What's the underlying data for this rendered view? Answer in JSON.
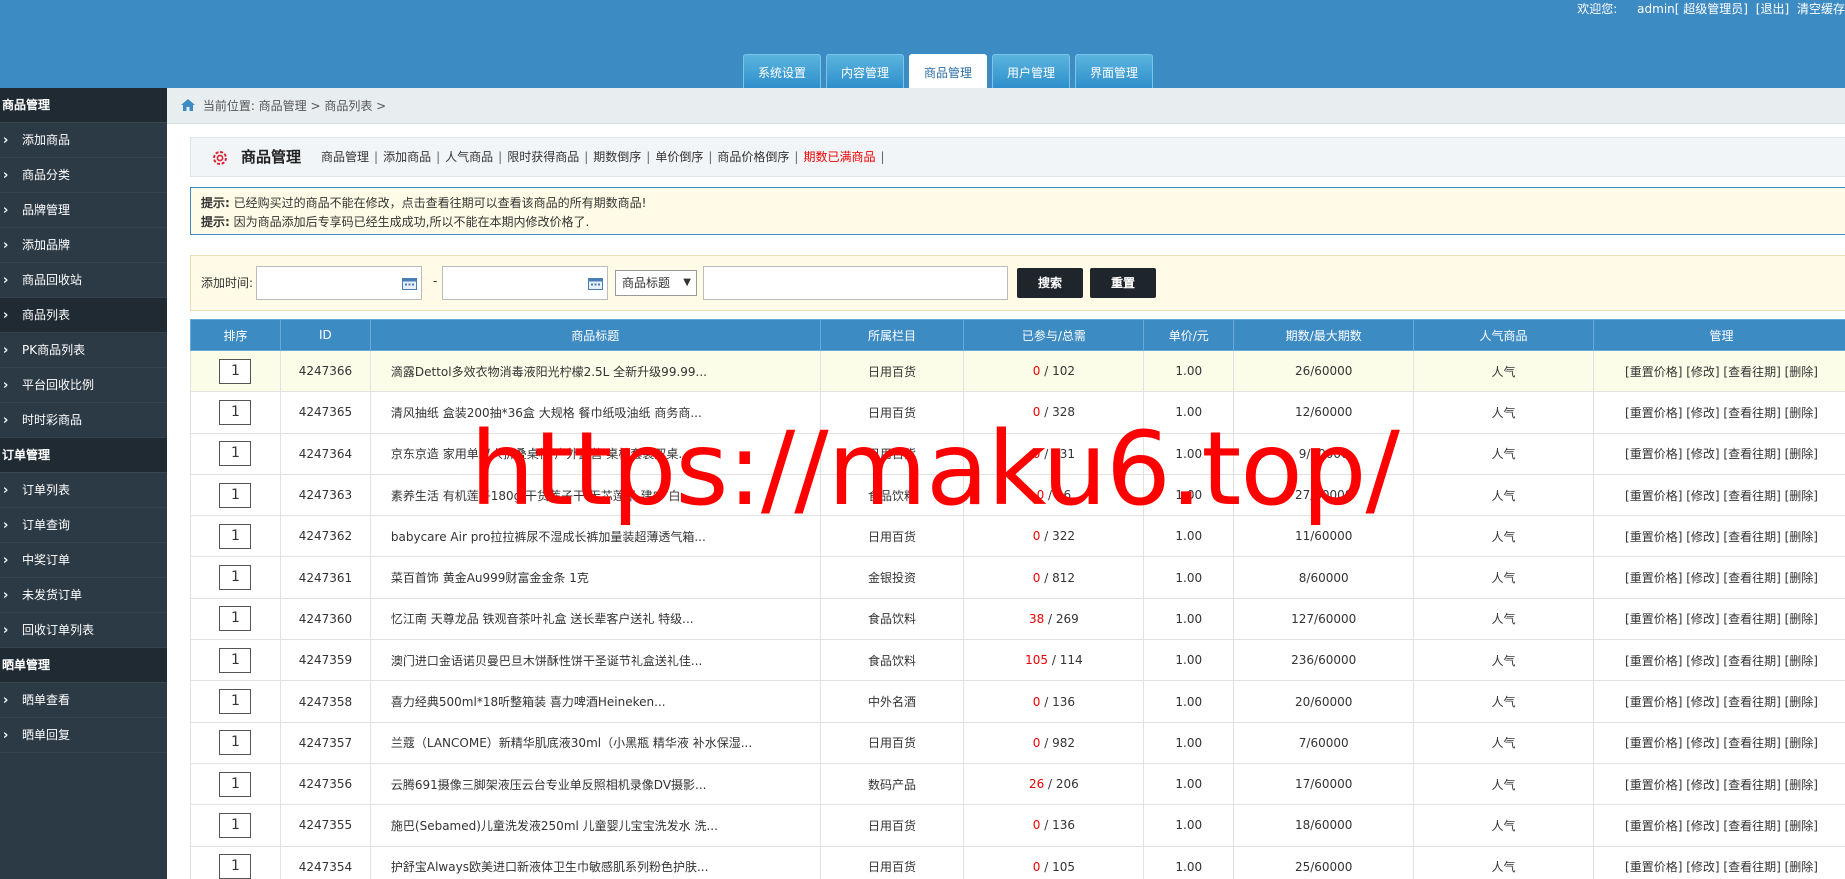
{
  "top_bar": {
    "welcome": "欢迎您:",
    "user": "admin[ 超级管理员]",
    "logout": "[退出]",
    "clear_cache": "清空缓存"
  },
  "nav_tabs": [
    {
      "label": "系统设置",
      "active": false
    },
    {
      "label": "内容管理",
      "active": false
    },
    {
      "label": "商品管理",
      "active": true
    },
    {
      "label": "用户管理",
      "active": false
    },
    {
      "label": "界面管理",
      "active": false
    }
  ],
  "sidebar": [
    {
      "type": "group",
      "label": "商品管理"
    },
    {
      "type": "item",
      "label": "添加商品"
    },
    {
      "type": "item",
      "label": "商品分类"
    },
    {
      "type": "item",
      "label": "品牌管理"
    },
    {
      "type": "item",
      "label": "添加品牌"
    },
    {
      "type": "item",
      "label": "商品回收站"
    },
    {
      "type": "item",
      "label": "商品列表",
      "active": true
    },
    {
      "type": "item",
      "label": "PK商品列表"
    },
    {
      "type": "item",
      "label": "平台回收比例"
    },
    {
      "type": "item",
      "label": "时时彩商品"
    },
    {
      "type": "group",
      "label": "订单管理"
    },
    {
      "type": "item",
      "label": "订单列表"
    },
    {
      "type": "item",
      "label": "订单查询"
    },
    {
      "type": "item",
      "label": "中奖订单"
    },
    {
      "type": "item",
      "label": "未发货订单"
    },
    {
      "type": "item",
      "label": "回收订单列表"
    },
    {
      "type": "group",
      "label": "晒单管理"
    },
    {
      "type": "item",
      "label": "晒单查看"
    },
    {
      "type": "item",
      "label": "晒单回复"
    }
  ],
  "breadcrumb": "当前位置: 商品管理 > 商品列表 >",
  "page_header": {
    "title": "商品管理",
    "links": [
      {
        "label": "商品管理",
        "red": false
      },
      {
        "label": "添加商品",
        "red": false
      },
      {
        "label": "人气商品",
        "red": false
      },
      {
        "label": "限时获得商品",
        "red": false
      },
      {
        "label": "期数倒序",
        "red": false
      },
      {
        "label": "单价倒序",
        "red": false
      },
      {
        "label": "商品价格倒序",
        "red": false
      },
      {
        "label": "期数已满商品",
        "red": true
      }
    ]
  },
  "tips": {
    "prefix": "提示:",
    "line1": " 已经购买过的商品不能在修改，点击查看往期可以查看该商品的所有期数商品!",
    "line2": " 因为商品添加后专享码已经生成成功,所以不能在本期内修改价格了."
  },
  "search": {
    "label": "添加时间:",
    "dash": "-",
    "field_select": "商品标题",
    "search_button": "搜索",
    "reset_button": "重置"
  },
  "table": {
    "headers": [
      "排序",
      "ID",
      "商品标题",
      "所属栏目",
      "已参与/总需",
      "单价/元",
      "期数/最大期数",
      "人气商品",
      "管理"
    ],
    "ops": "[重置价格] [修改] [查看往期] [删除]",
    "rows": [
      {
        "sort": "1",
        "id": "4247366",
        "title": "滴露Dettol多效衣物消毒液阳光柠檬2.5L 全新升级99.99...",
        "cat": "日用百货",
        "joined": "0",
        "total": "/ 102",
        "price": "1.00",
        "period": "26/60000",
        "hot": "人气"
      },
      {
        "sort": "1",
        "id": "4247365",
        "title": "清风抽纸 盒装200抽*36盒 大规格 餐巾纸吸油纸 商务商...",
        "cat": "日用百货",
        "joined": "0",
        "total": "/ 328",
        "price": "1.00",
        "period": "12/60000",
        "hot": "人气"
      },
      {
        "sort": "1",
        "id": "4247364",
        "title": "京东京造 家用单双人折叠桌椅 户外露营 桌椅套装双桌...",
        "cat": "日用百货",
        "joined": "0",
        "total": "/ 131",
        "price": "1.00",
        "period": "9/60000",
        "hot": "人气"
      },
      {
        "sort": "1",
        "id": "4247363",
        "title": "素养生活 有机莲子180g 干货莲子干 无芯莲子 建宁 白...",
        "cat": "食品饮料",
        "joined": "0",
        "total": "/ 16",
        "price": "1.00",
        "period": "27/60000",
        "hot": "人气"
      },
      {
        "sort": "1",
        "id": "4247362",
        "title": "babycare Air pro拉拉裤尿不湿成长裤加量装超薄透气箱...",
        "cat": "日用百货",
        "joined": "0",
        "total": "/ 322",
        "price": "1.00",
        "period": "11/60000",
        "hot": "人气"
      },
      {
        "sort": "1",
        "id": "4247361",
        "title": "菜百首饰 黄金Au999财富金金条 1克",
        "cat": "金银投资",
        "joined": "0",
        "total": "/ 812",
        "price": "1.00",
        "period": "8/60000",
        "hot": "人气"
      },
      {
        "sort": "1",
        "id": "4247360",
        "title": "忆江南 天尊龙品 铁观音茶叶礼盒 送长辈客户送礼 特级...",
        "cat": "食品饮料",
        "joined": "38",
        "total": "/ 269",
        "price": "1.00",
        "period": "127/60000",
        "hot": "人气"
      },
      {
        "sort": "1",
        "id": "4247359",
        "title": "澳门进口金语诺贝曼巴旦木饼酥性饼干圣诞节礼盒送礼佳...",
        "cat": "食品饮料",
        "joined": "105",
        "total": "/ 114",
        "price": "1.00",
        "period": "236/60000",
        "hot": "人气"
      },
      {
        "sort": "1",
        "id": "4247358",
        "title": "喜力经典500ml*18听整箱装 喜力啤酒Heineken...",
        "cat": "中外名酒",
        "joined": "0",
        "total": "/ 136",
        "price": "1.00",
        "period": "20/60000",
        "hot": "人气"
      },
      {
        "sort": "1",
        "id": "4247357",
        "title": "兰蔻（LANCOME）新精华肌底液30ml（小黑瓶 精华液 补水保湿...",
        "cat": "日用百货",
        "joined": "0",
        "total": "/ 982",
        "price": "1.00",
        "period": "7/60000",
        "hot": "人气"
      },
      {
        "sort": "1",
        "id": "4247356",
        "title": "云腾691摄像三脚架液压云台专业单反照相机录像DV摄影...",
        "cat": "数码产品",
        "joined": "26",
        "total": "/ 206",
        "price": "1.00",
        "period": "17/60000",
        "hot": "人气"
      },
      {
        "sort": "1",
        "id": "4247355",
        "title": "施巴(Sebamed)儿童洗发液250ml 儿童婴儿宝宝洗发水 洗...",
        "cat": "日用百货",
        "joined": "0",
        "total": "/ 136",
        "price": "1.00",
        "period": "18/60000",
        "hot": "人气"
      },
      {
        "sort": "1",
        "id": "4247354",
        "title": "护舒宝Always欧美进口新液体卫生巾敏感肌系列粉色护肤...",
        "cat": "日用百货",
        "joined": "0",
        "total": "/ 105",
        "price": "1.00",
        "period": "25/60000",
        "hot": "人气"
      }
    ]
  },
  "watermark": "https://maku6.top/",
  "colors": {
    "header_blue": "#3d8bc3",
    "sidebar_dark": "#2c3a45",
    "accent_red": "#e00000"
  }
}
